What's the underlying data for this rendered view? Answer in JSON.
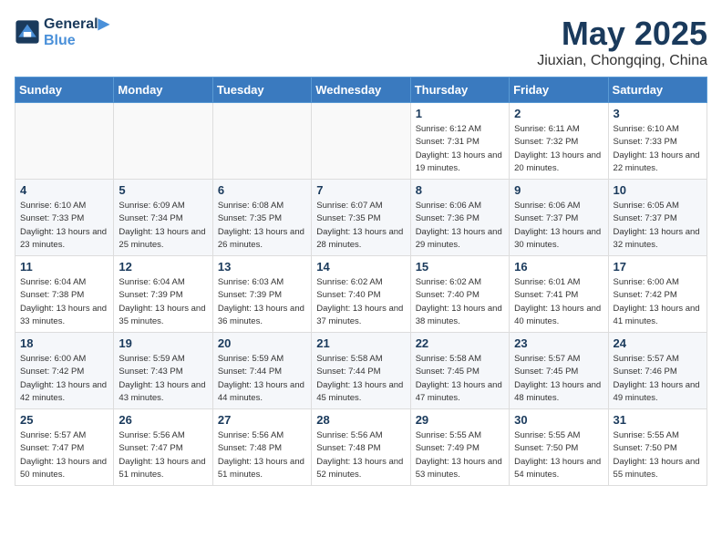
{
  "logo": {
    "line1": "General",
    "line2": "Blue"
  },
  "title": "May 2025",
  "subtitle": "Jiuxian, Chongqing, China",
  "days_of_week": [
    "Sunday",
    "Monday",
    "Tuesday",
    "Wednesday",
    "Thursday",
    "Friday",
    "Saturday"
  ],
  "weeks": [
    [
      {
        "day": "",
        "info": ""
      },
      {
        "day": "",
        "info": ""
      },
      {
        "day": "",
        "info": ""
      },
      {
        "day": "",
        "info": ""
      },
      {
        "day": "1",
        "info": "Sunrise: 6:12 AM\nSunset: 7:31 PM\nDaylight: 13 hours and 19 minutes."
      },
      {
        "day": "2",
        "info": "Sunrise: 6:11 AM\nSunset: 7:32 PM\nDaylight: 13 hours and 20 minutes."
      },
      {
        "day": "3",
        "info": "Sunrise: 6:10 AM\nSunset: 7:33 PM\nDaylight: 13 hours and 22 minutes."
      }
    ],
    [
      {
        "day": "4",
        "info": "Sunrise: 6:10 AM\nSunset: 7:33 PM\nDaylight: 13 hours and 23 minutes."
      },
      {
        "day": "5",
        "info": "Sunrise: 6:09 AM\nSunset: 7:34 PM\nDaylight: 13 hours and 25 minutes."
      },
      {
        "day": "6",
        "info": "Sunrise: 6:08 AM\nSunset: 7:35 PM\nDaylight: 13 hours and 26 minutes."
      },
      {
        "day": "7",
        "info": "Sunrise: 6:07 AM\nSunset: 7:35 PM\nDaylight: 13 hours and 28 minutes."
      },
      {
        "day": "8",
        "info": "Sunrise: 6:06 AM\nSunset: 7:36 PM\nDaylight: 13 hours and 29 minutes."
      },
      {
        "day": "9",
        "info": "Sunrise: 6:06 AM\nSunset: 7:37 PM\nDaylight: 13 hours and 30 minutes."
      },
      {
        "day": "10",
        "info": "Sunrise: 6:05 AM\nSunset: 7:37 PM\nDaylight: 13 hours and 32 minutes."
      }
    ],
    [
      {
        "day": "11",
        "info": "Sunrise: 6:04 AM\nSunset: 7:38 PM\nDaylight: 13 hours and 33 minutes."
      },
      {
        "day": "12",
        "info": "Sunrise: 6:04 AM\nSunset: 7:39 PM\nDaylight: 13 hours and 35 minutes."
      },
      {
        "day": "13",
        "info": "Sunrise: 6:03 AM\nSunset: 7:39 PM\nDaylight: 13 hours and 36 minutes."
      },
      {
        "day": "14",
        "info": "Sunrise: 6:02 AM\nSunset: 7:40 PM\nDaylight: 13 hours and 37 minutes."
      },
      {
        "day": "15",
        "info": "Sunrise: 6:02 AM\nSunset: 7:40 PM\nDaylight: 13 hours and 38 minutes."
      },
      {
        "day": "16",
        "info": "Sunrise: 6:01 AM\nSunset: 7:41 PM\nDaylight: 13 hours and 40 minutes."
      },
      {
        "day": "17",
        "info": "Sunrise: 6:00 AM\nSunset: 7:42 PM\nDaylight: 13 hours and 41 minutes."
      }
    ],
    [
      {
        "day": "18",
        "info": "Sunrise: 6:00 AM\nSunset: 7:42 PM\nDaylight: 13 hours and 42 minutes."
      },
      {
        "day": "19",
        "info": "Sunrise: 5:59 AM\nSunset: 7:43 PM\nDaylight: 13 hours and 43 minutes."
      },
      {
        "day": "20",
        "info": "Sunrise: 5:59 AM\nSunset: 7:44 PM\nDaylight: 13 hours and 44 minutes."
      },
      {
        "day": "21",
        "info": "Sunrise: 5:58 AM\nSunset: 7:44 PM\nDaylight: 13 hours and 45 minutes."
      },
      {
        "day": "22",
        "info": "Sunrise: 5:58 AM\nSunset: 7:45 PM\nDaylight: 13 hours and 47 minutes."
      },
      {
        "day": "23",
        "info": "Sunrise: 5:57 AM\nSunset: 7:45 PM\nDaylight: 13 hours and 48 minutes."
      },
      {
        "day": "24",
        "info": "Sunrise: 5:57 AM\nSunset: 7:46 PM\nDaylight: 13 hours and 49 minutes."
      }
    ],
    [
      {
        "day": "25",
        "info": "Sunrise: 5:57 AM\nSunset: 7:47 PM\nDaylight: 13 hours and 50 minutes."
      },
      {
        "day": "26",
        "info": "Sunrise: 5:56 AM\nSunset: 7:47 PM\nDaylight: 13 hours and 51 minutes."
      },
      {
        "day": "27",
        "info": "Sunrise: 5:56 AM\nSunset: 7:48 PM\nDaylight: 13 hours and 51 minutes."
      },
      {
        "day": "28",
        "info": "Sunrise: 5:56 AM\nSunset: 7:48 PM\nDaylight: 13 hours and 52 minutes."
      },
      {
        "day": "29",
        "info": "Sunrise: 5:55 AM\nSunset: 7:49 PM\nDaylight: 13 hours and 53 minutes."
      },
      {
        "day": "30",
        "info": "Sunrise: 5:55 AM\nSunset: 7:50 PM\nDaylight: 13 hours and 54 minutes."
      },
      {
        "day": "31",
        "info": "Sunrise: 5:55 AM\nSunset: 7:50 PM\nDaylight: 13 hours and 55 minutes."
      }
    ]
  ]
}
